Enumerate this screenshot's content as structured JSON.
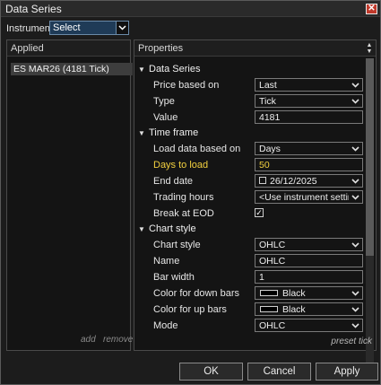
{
  "window": {
    "title": "Data Series"
  },
  "instrument": {
    "label": "Instrument",
    "value": "Select"
  },
  "applied": {
    "header": "Applied",
    "items": [
      "ES MAR26 (4181 Tick)"
    ],
    "add_label": "add",
    "remove_label": "remove"
  },
  "properties": {
    "header": "Properties",
    "preset_label": "preset tick",
    "sections": [
      {
        "title": "Data Series",
        "rows": [
          {
            "label": "Price based on",
            "value": "Last"
          },
          {
            "label": "Type",
            "value": "Tick"
          },
          {
            "label": "Value",
            "value": "4181"
          }
        ]
      },
      {
        "title": "Time frame",
        "rows": [
          {
            "label": "Load data based on",
            "value": "Days"
          },
          {
            "label": "Days to load",
            "value": "50"
          },
          {
            "label": "End date",
            "value": "26/12/2025"
          },
          {
            "label": "Trading hours",
            "value": "<Use instrument settin..."
          },
          {
            "label": "Break at EOD",
            "value": "✓"
          }
        ]
      },
      {
        "title": "Chart style",
        "rows": [
          {
            "label": "Chart style",
            "value": "OHLC"
          },
          {
            "label": "Name",
            "value": "OHLC"
          },
          {
            "label": "Bar width",
            "value": "1"
          },
          {
            "label": "Color for down bars",
            "value": "Black"
          },
          {
            "label": "Color for up bars",
            "value": "Black"
          },
          {
            "label": "Mode",
            "value": "OHLC"
          }
        ]
      }
    ]
  },
  "buttons": {
    "ok": "OK",
    "cancel": "Cancel",
    "apply": "Apply"
  },
  "colors": {
    "highlight": "#f2d03f",
    "close": "#c0392b",
    "select_bg": "#1f3b57"
  }
}
